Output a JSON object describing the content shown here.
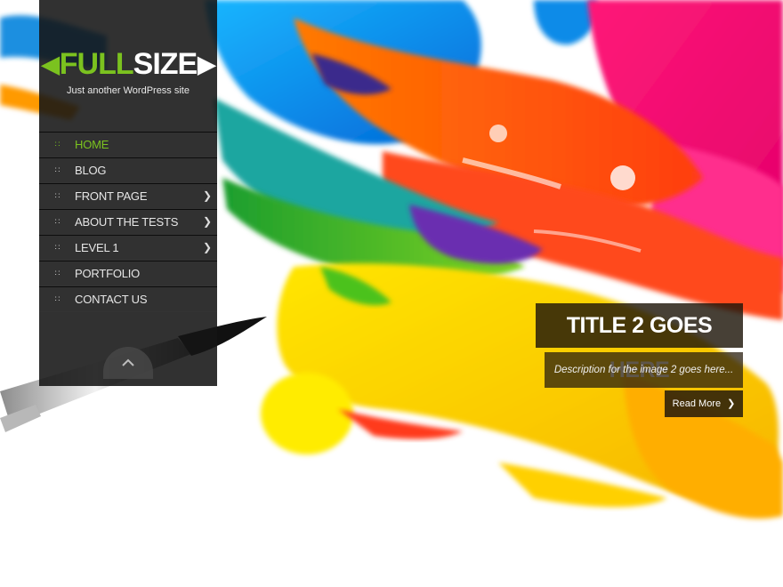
{
  "site": {
    "logo_part_a": "FULL",
    "logo_part_b": "SIZE",
    "tagline": "Just another WordPress site",
    "accent_color": "#7bc21f"
  },
  "menu": {
    "items": [
      {
        "label": "HOME",
        "active": true,
        "has_submenu": false
      },
      {
        "label": "BLOG",
        "active": false,
        "has_submenu": false
      },
      {
        "label": "FRONT PAGE",
        "active": false,
        "has_submenu": true
      },
      {
        "label": "ABOUT THE TESTS",
        "active": false,
        "has_submenu": true
      },
      {
        "label": "LEVEL 1",
        "active": false,
        "has_submenu": true
      },
      {
        "label": "PORTFOLIO",
        "active": false,
        "has_submenu": false
      },
      {
        "label": "CONTACT US",
        "active": false,
        "has_submenu": false
      }
    ],
    "bullet_icon": "move-icon",
    "submenu_icon": "chevron-right-icon"
  },
  "sidebar": {
    "collapse_icon": "chevron-up-icon"
  },
  "slide": {
    "title": "TITLE 2 GOES HERE",
    "description": "Description for the image 2 goes here...",
    "read_more_label": "Read More",
    "read_more_icon": "chevron-right-icon"
  }
}
